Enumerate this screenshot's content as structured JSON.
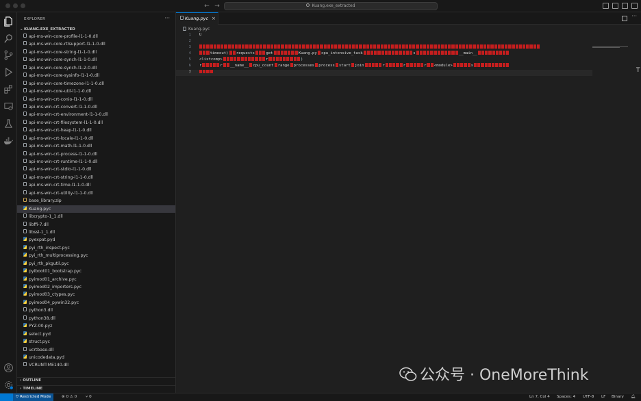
{
  "window": {
    "command_center_text": "Kuang.exe_extracted"
  },
  "sidebar": {
    "title": "EXPLORER",
    "more": "···",
    "folder": "KUANG.EXE_EXTRACTED",
    "files": [
      "api-ms-win-core-profile-l1-1-0.dll",
      "api-ms-win-core-rtlsupport-l1-1-0.dll",
      "api-ms-win-core-string-l1-1-0.dll",
      "api-ms-win-core-synch-l1-1-0.dll",
      "api-ms-win-core-synch-l1-2-0.dll",
      "api-ms-win-core-sysinfo-l1-1-0.dll",
      "api-ms-win-core-timezone-l1-1-0.dll",
      "api-ms-win-core-util-l1-1-0.dll",
      "api-ms-win-crt-conio-l1-1-0.dll",
      "api-ms-win-crt-convert-l1-1-0.dll",
      "api-ms-win-crt-environment-l1-1-0.dll",
      "api-ms-win-crt-filesystem-l1-1-0.dll",
      "api-ms-win-crt-heap-l1-1-0.dll",
      "api-ms-win-crt-locale-l1-1-0.dll",
      "api-ms-win-crt-math-l1-1-0.dll",
      "api-ms-win-crt-process-l1-1-0.dll",
      "api-ms-win-crt-runtime-l1-1-0.dll",
      "api-ms-win-crt-stdio-l1-1-0.dll",
      "api-ms-win-crt-string-l1-1-0.dll",
      "api-ms-win-crt-time-l1-1-0.dll",
      "api-ms-win-crt-utility-l1-1-0.dll",
      "base_library.zip",
      "Kuang.pyc",
      "libcrypto-1_1.dll",
      "libffi-7.dll",
      "libssl-1_1.dll",
      "pyexpat.pyd",
      "pyi_rth_inspect.pyc",
      "pyi_rth_multiprocessing.pyc",
      "pyi_rth_pkgutil.pyc",
      "pyiboot01_bootstrap.pyc",
      "pyimod01_archive.pyc",
      "pyimod02_importers.pyc",
      "pyimod03_ctypes.pyc",
      "pyimod04_pywin32.pyc",
      "python3.dll",
      "python38.dll",
      "PYZ-00.pyz",
      "select.pyd",
      "struct.pyc",
      "ucrtbase.dll",
      "unicodedata.pyd",
      "VCRUNTIME140.dll"
    ],
    "file_kinds": [
      "def",
      "def",
      "def",
      "def",
      "def",
      "def",
      "def",
      "def",
      "def",
      "def",
      "def",
      "def",
      "def",
      "def",
      "def",
      "def",
      "def",
      "def",
      "def",
      "def",
      "def",
      "zip",
      "py",
      "def",
      "def",
      "def",
      "py",
      "py",
      "py",
      "py",
      "py",
      "py",
      "py",
      "py",
      "py",
      "def",
      "def",
      "py",
      "py",
      "py",
      "def",
      "py",
      "def"
    ],
    "selected_index": 22,
    "outline": "OUTLINE",
    "timeline": "TIMELINE"
  },
  "editor": {
    "tab_label": "Kuang.pyc",
    "tab_close": "×",
    "breadcrumb": "Kuang.pyc",
    "line_numbers": [
      "1",
      "2",
      "3",
      "4",
      "5",
      "6",
      "7"
    ],
    "active_line": "7",
    "line1": "U",
    "line4_tokens": [
      "timeout)",
      "requests",
      "get",
      "Kuang.py",
      "cpu_intensive_task",
      "s",
      "__main__"
    ],
    "line5_tokens": [
      "<listcomp>",
      "r",
      ")"
    ],
    "line6_tokens": [
      "r",
      "r",
      "__name__",
      "cpu_count",
      "range",
      "processes",
      "process",
      "start",
      "join",
      "r",
      "r",
      "r",
      "<module>",
      "s"
    ],
    "scroll_glyph": "T"
  },
  "statusbar": {
    "restricted": "Restricted Mode",
    "problems": "⊗ 0 ⚠ 0",
    "ports": "⑂ 0",
    "position": "Ln 7, Col 4",
    "spaces": "Spaces: 4",
    "encoding": "UTF-8",
    "eol": "LF",
    "language": "Binary"
  },
  "watermark": {
    "text": "公众号 · OneMoreThink"
  }
}
